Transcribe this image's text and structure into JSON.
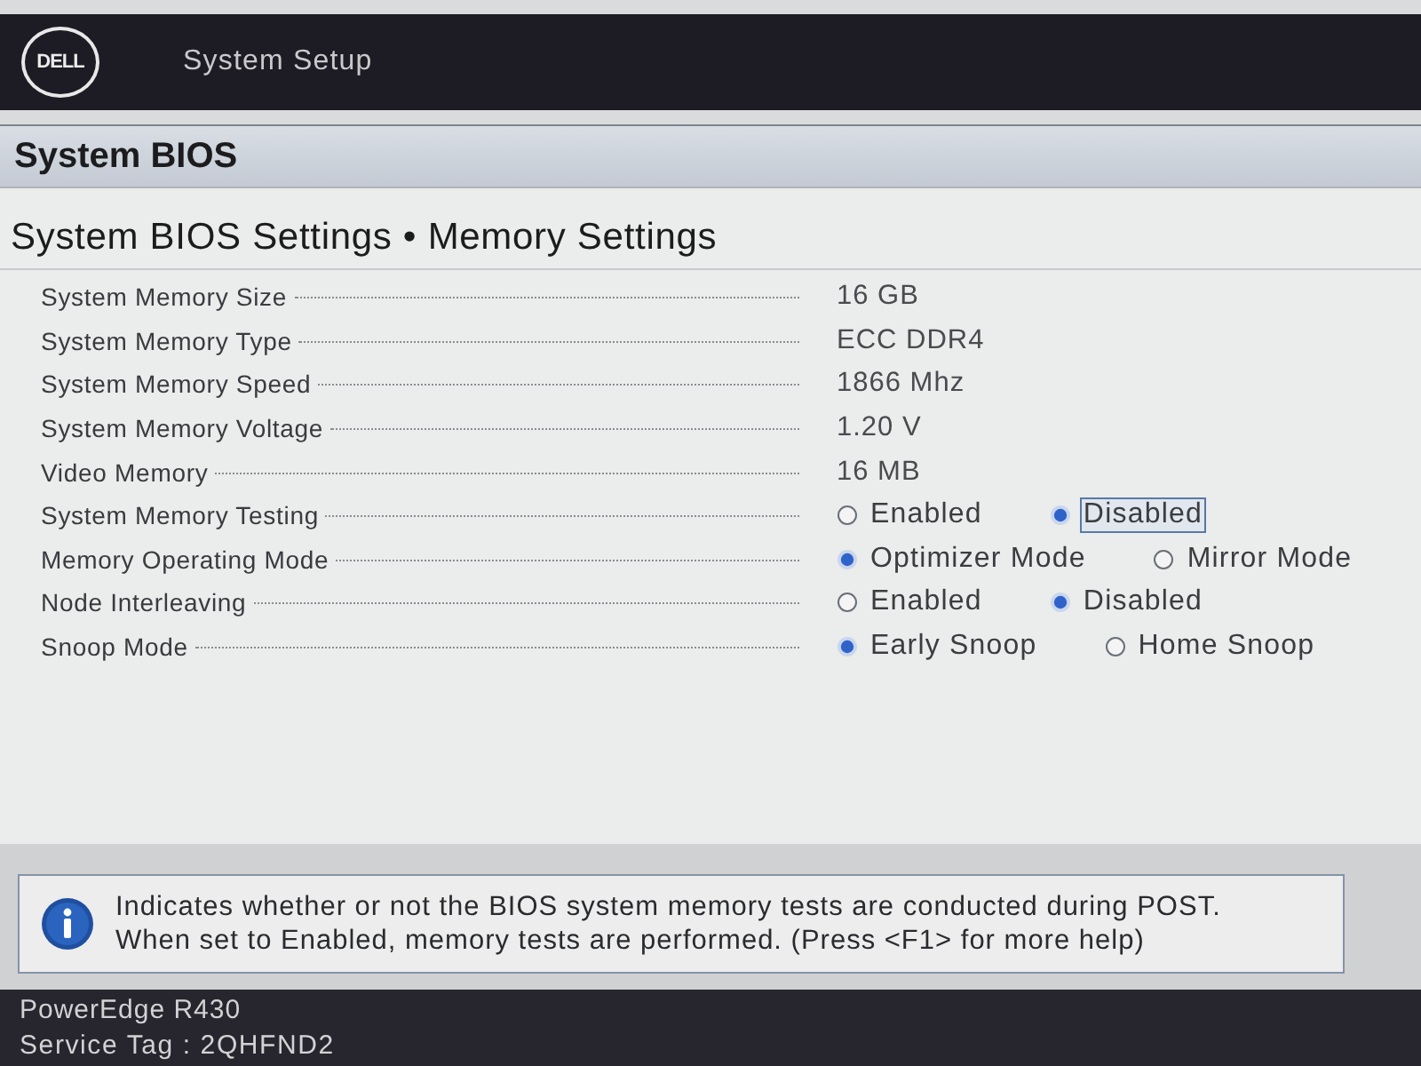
{
  "header": {
    "logo": "DELL",
    "title": "System Setup"
  },
  "section_bar": {
    "title": "System BIOS"
  },
  "page": {
    "breadcrumb": "System BIOS Settings • Memory Settings"
  },
  "settings": [
    {
      "label": "System Memory Size",
      "kind": "text",
      "value": "16 GB"
    },
    {
      "label": "System Memory Type",
      "kind": "text",
      "value": "ECC DDR4"
    },
    {
      "label": "System Memory Speed",
      "kind": "text",
      "value": "1866 Mhz"
    },
    {
      "label": "System Memory Voltage",
      "kind": "text",
      "value": "1.20 V"
    },
    {
      "label": "Video Memory",
      "kind": "text",
      "value": "16 MB"
    },
    {
      "label": "System Memory Testing",
      "kind": "radio",
      "options": [
        {
          "label": "Enabled",
          "selected": false,
          "focused": false
        },
        {
          "label": "Disabled",
          "selected": true,
          "focused": true
        }
      ]
    },
    {
      "label": "Memory Operating Mode",
      "kind": "radio",
      "options": [
        {
          "label": "Optimizer Mode",
          "selected": true,
          "focused": false
        },
        {
          "label": "Mirror Mode",
          "selected": false,
          "focused": false
        }
      ]
    },
    {
      "label": "Node Interleaving",
      "kind": "radio",
      "options": [
        {
          "label": "Enabled",
          "selected": false,
          "focused": false
        },
        {
          "label": "Disabled",
          "selected": true,
          "focused": false
        }
      ]
    },
    {
      "label": "Snoop Mode",
      "kind": "radio",
      "options": [
        {
          "label": "Early Snoop",
          "selected": true,
          "focused": false
        },
        {
          "label": "Home Snoop",
          "selected": false,
          "focused": false
        }
      ]
    }
  ],
  "help": {
    "lines": [
      "Indicates whether or not the BIOS system memory tests are conducted during POST.",
      "When set to Enabled, memory tests are performed. (Press <F1> for more help)"
    ]
  },
  "footer": {
    "model": "PowerEdge R430",
    "service_tag": "Service Tag : 2QHFND2"
  }
}
